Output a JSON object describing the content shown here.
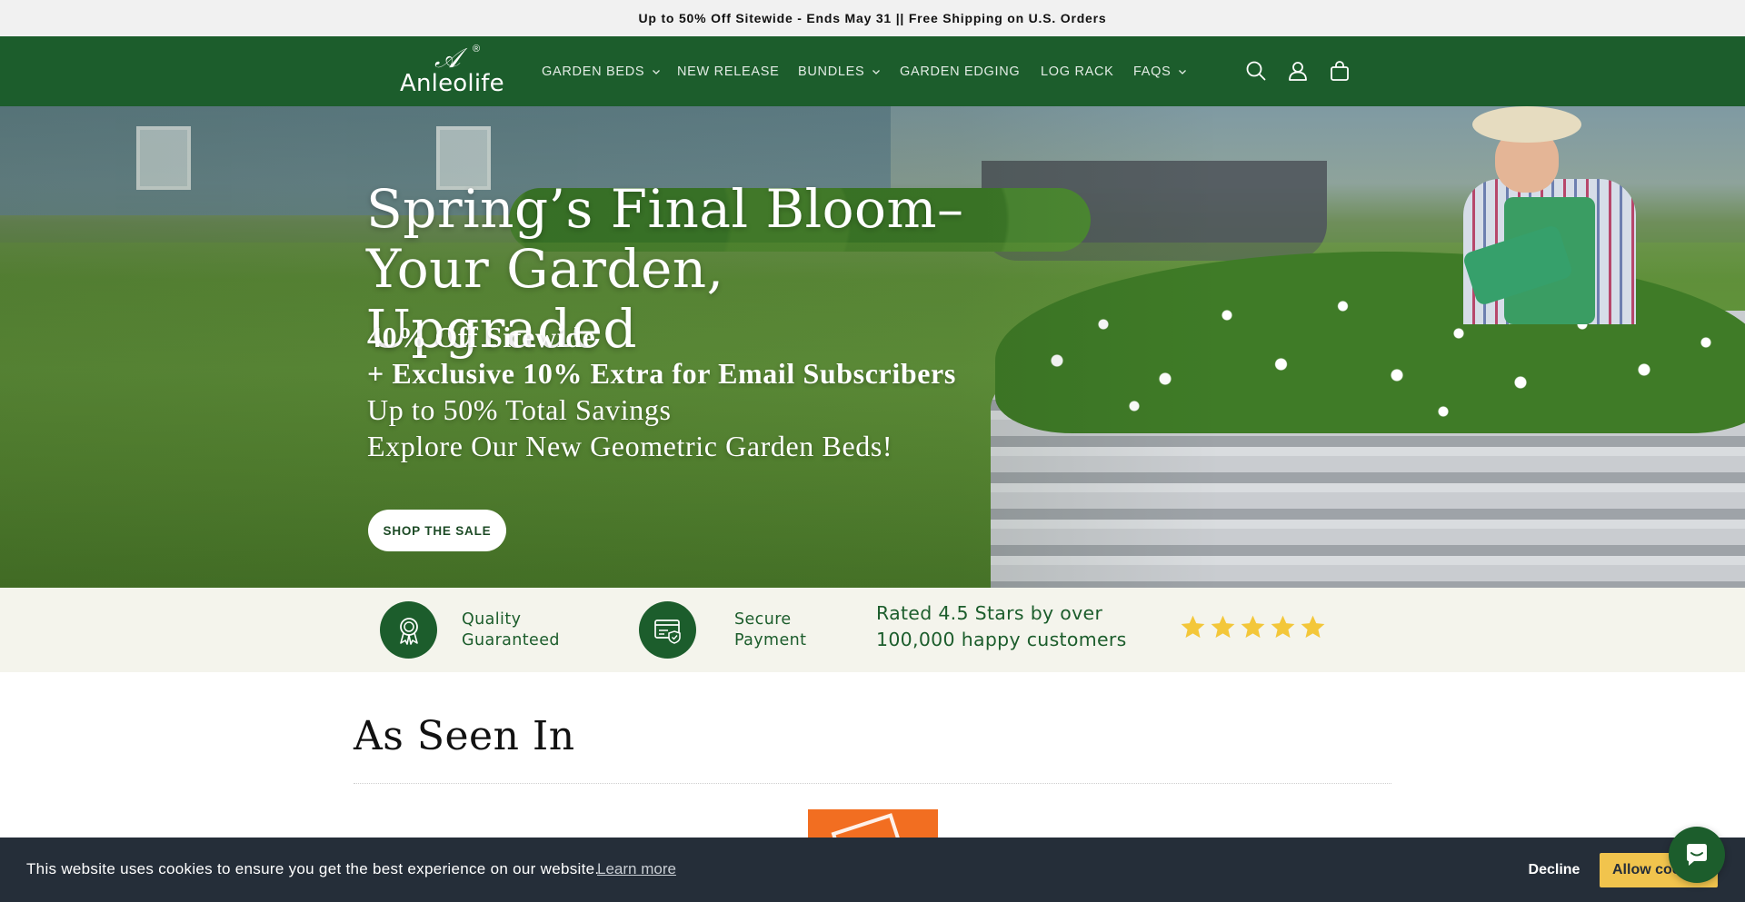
{
  "announcement": "Up to 50% Off Sitewide - Ends May 31 || Free Shipping on U.S. Orders",
  "brand": {
    "name": "Anleolife",
    "reg_mark": "®",
    "accent_color": "#1c5d2c"
  },
  "nav": [
    {
      "label": "GARDEN BEDS",
      "dropdown": true
    },
    {
      "label": "NEW RELEASE",
      "dropdown": false
    },
    {
      "label": "BUNDLES",
      "dropdown": true
    },
    {
      "label": "GARDEN EDGING",
      "dropdown": false
    },
    {
      "label": "LOG RACK",
      "dropdown": false
    },
    {
      "label": "FAQS",
      "dropdown": true
    }
  ],
  "header_icons": [
    "search-icon",
    "account-icon",
    "cart-icon"
  ],
  "hero": {
    "title_line1": "Spring’s Final Bloom–",
    "title_line2": "Your Garden, Upgraded",
    "line1": "40% Off Sitewide",
    "line2": "+ Exclusive 10% Extra for Email Subscribers",
    "line3": "Up to 50% Total Savings",
    "line4": "Explore Our New Geometric Garden Beds!",
    "cta": "SHOP THE SALE"
  },
  "trust": {
    "quality_line1": "Quality",
    "quality_line2": "Guaranteed",
    "payment_line1": "Secure",
    "payment_line2": "Payment",
    "rated_line1": "Rated 4.5 Stars by over",
    "rated_line2": "100,000 happy customers",
    "stars_shown": 5
  },
  "seen_in": {
    "title": "As Seen In"
  },
  "cookie": {
    "message": "This website uses cookies to ensure you get the best experience on our website.",
    "learn_more": "Learn more",
    "decline": "Decline",
    "allow": "Allow cookies"
  }
}
